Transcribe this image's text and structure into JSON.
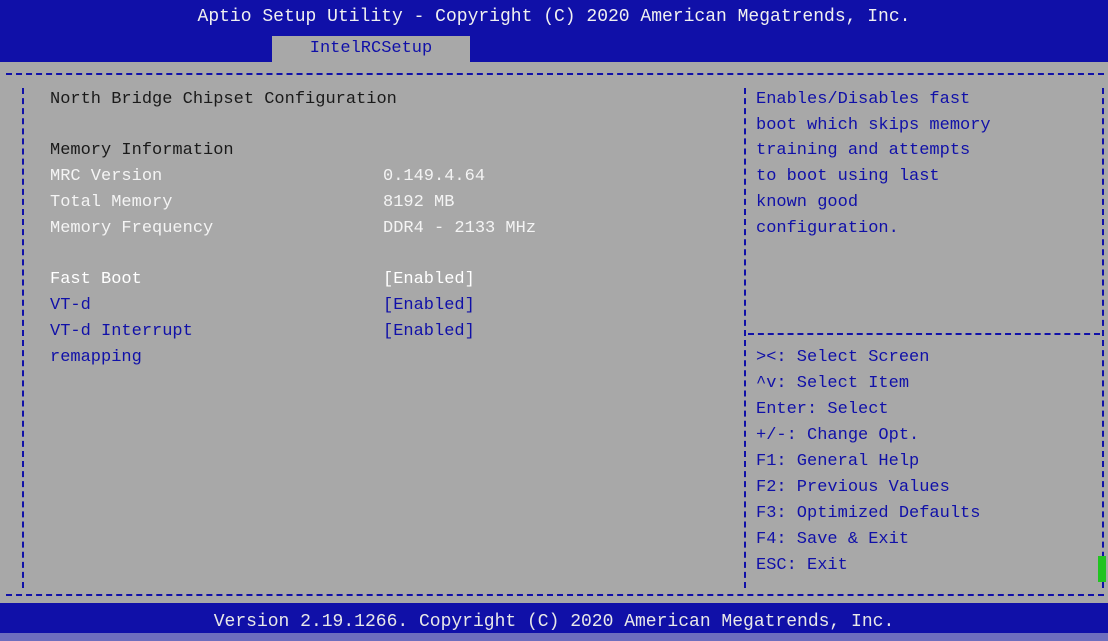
{
  "header": {
    "title": "Aptio Setup Utility - Copyright (C) 2020 American Megatrends, Inc.",
    "active_tab": "IntelRCSetup"
  },
  "main": {
    "page_title": "North Bridge Chipset Configuration",
    "section_heading": "Memory Information",
    "info_rows": [
      {
        "label": "MRC Version",
        "value": "0.149.4.64"
      },
      {
        "label": "Total Memory",
        "value": "8192 MB"
      },
      {
        "label": "Memory Frequency",
        "value": "DDR4 - 2133 MHz"
      }
    ],
    "options": [
      {
        "label": "Fast Boot",
        "value": "[Enabled]",
        "selected": true
      },
      {
        "label": "VT-d",
        "value": "[Enabled]"
      },
      {
        "label": "VT-d Interrupt",
        "label2": "remapping",
        "value": "[Enabled]"
      }
    ]
  },
  "help": {
    "lines": [
      "Enables/Disables fast",
      "boot which skips memory",
      "training and attempts",
      "to boot using last",
      "known good",
      "configuration."
    ]
  },
  "keys": {
    "lines": [
      "><: Select Screen",
      "^v: Select Item",
      "Enter: Select",
      "+/-: Change Opt.",
      "F1: General Help",
      "F2: Previous Values",
      "F3: Optimized Defaults",
      "F4: Save & Exit",
      "ESC: Exit"
    ]
  },
  "footer": {
    "version_text": "Version 2.19.1266. Copyright (C) 2020 American Megatrends, Inc."
  },
  "colors": {
    "bar_blue": "#1010a8",
    "panel_gray": "#a8a8a8",
    "highlight_white": "#ffffff",
    "cursor_green": "#21c421"
  }
}
